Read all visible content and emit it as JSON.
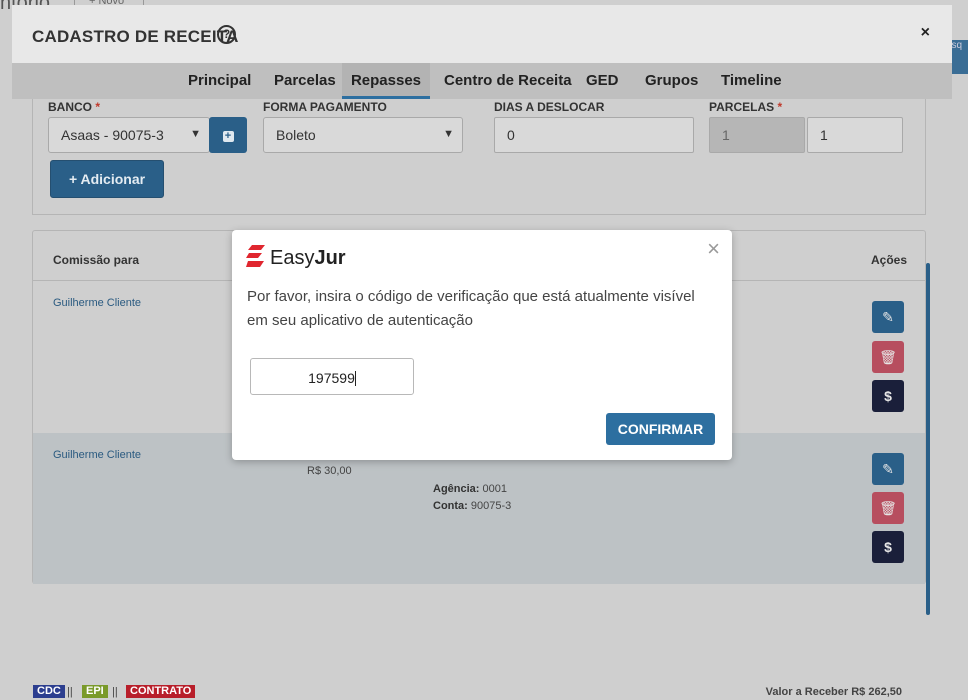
{
  "background": {
    "top_title": "ntório",
    "new_button": "+ Novo",
    "right_button": "esq",
    "tags": [
      {
        "label": "CDC",
        "color": "#2c3e8f"
      },
      {
        "label": "EPI",
        "color": "#7a9a2a"
      },
      {
        "label": "CONTRATO",
        "color": "#b81e2a"
      }
    ],
    "separator": "||",
    "footer_value": "Valor a Receber R$ 262,50"
  },
  "modal": {
    "title": "CADASTRO DE RECEITA",
    "help_icon": "?",
    "close_icon": "×",
    "tabs": [
      {
        "label": "Principal"
      },
      {
        "label": "Parcelas"
      },
      {
        "label": "Repasses",
        "active": true
      },
      {
        "label": "Centro de Receita"
      },
      {
        "label": "GED"
      },
      {
        "label": "Grupos"
      },
      {
        "label": "Timeline"
      }
    ]
  },
  "form": {
    "banco_label": "BANCO",
    "required_mark": "*",
    "banco_value": "Asaas - 90075-3",
    "add_bank_icon": "+",
    "forma_label": "FORMA PAGAMENTO",
    "forma_value": "Boleto",
    "dias_label": "DIAS A DESLOCAR",
    "dias_value": "0",
    "parcelas_label": "PARCELAS",
    "parcelas_value_disabled": "1",
    "parcelas_value": "1",
    "add_button": "+ Adicionar"
  },
  "table": {
    "col_comissao": "Comissão para",
    "col_acoes": "Ações",
    "rows": [
      {
        "cliente": "Guilherme Cliente"
      },
      {
        "cliente": "Guilherme Cliente",
        "valor": "R$ 30,00",
        "agencia_label": "Agência:",
        "agencia_value": "0001",
        "conta_label": "Conta:",
        "conta_value": "90075-3"
      }
    ],
    "money_icon": "$"
  },
  "dialog": {
    "logo_easy": "Easy",
    "logo_jur": "Jur",
    "close_icon": "×",
    "message": "Por favor, insira o código de verificação que está atualmente visível em seu aplicativo de autenticação",
    "code_value": "197599",
    "confirm_label": "CONFIRMAR"
  }
}
